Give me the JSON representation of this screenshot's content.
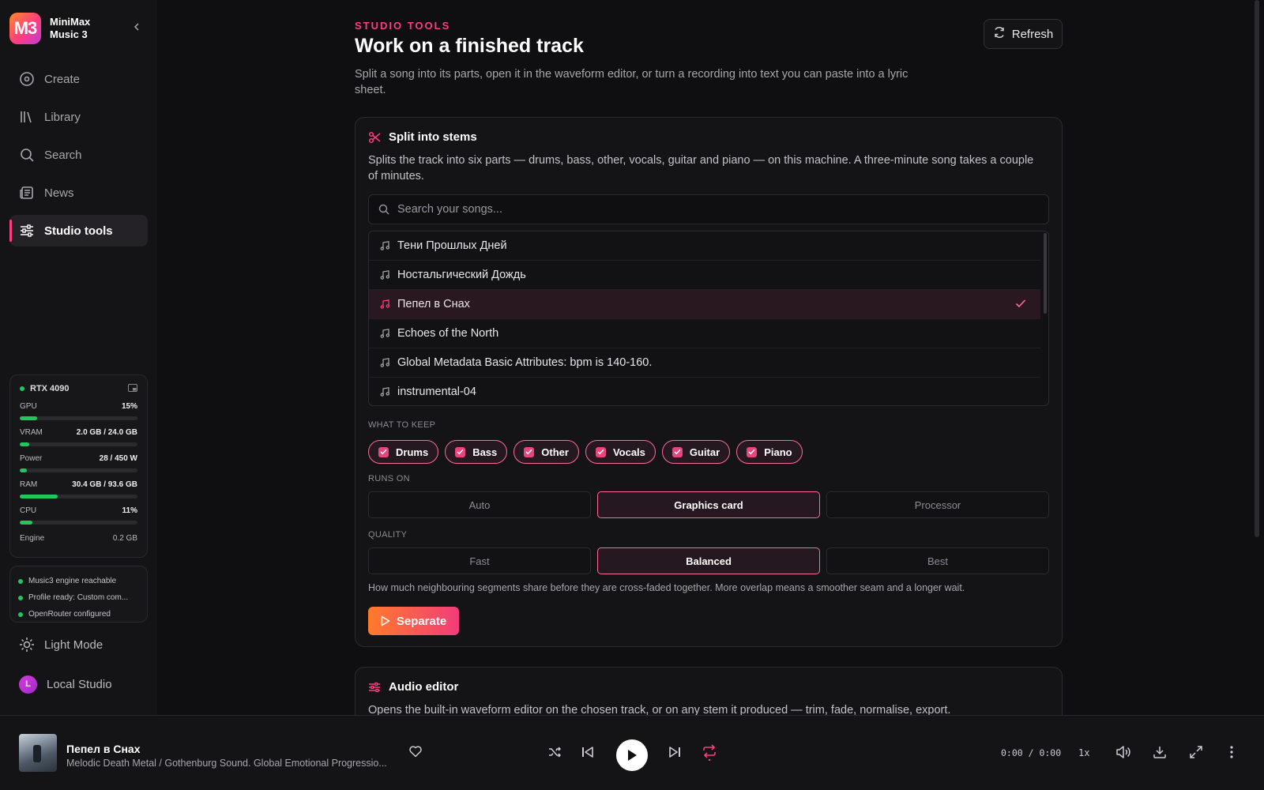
{
  "brand": {
    "logo": "M3",
    "name": "MiniMax Music 3"
  },
  "nav": [
    {
      "label": "Create",
      "icon": "disc-icon"
    },
    {
      "label": "Library",
      "icon": "library-icon"
    },
    {
      "label": "Search",
      "icon": "search-icon"
    },
    {
      "label": "News",
      "icon": "newspaper-icon"
    },
    {
      "label": "Studio tools",
      "icon": "sliders-icon",
      "active": true
    }
  ],
  "hardware": {
    "name": "RTX 4090",
    "metrics": [
      {
        "label": "GPU",
        "value": "15%",
        "fill": 0.15
      },
      {
        "label": "VRAM",
        "value": "2.0 GB / 24.0 GB",
        "fill": 0.083
      },
      {
        "label": "Power",
        "value": "28 / 450 W",
        "fill": 0.062
      },
      {
        "label": "RAM",
        "value": "30.4 GB / 93.6 GB",
        "fill": 0.325
      },
      {
        "label": "CPU",
        "value": "11%",
        "fill": 0.11
      }
    ],
    "engine_label": "Engine",
    "engine_value": "0.2 GB"
  },
  "status": [
    "Music3 engine reachable",
    "Profile ready: Custom com...",
    "OpenRouter configured"
  ],
  "sidebar_bottom": {
    "theme_label": "Light Mode",
    "user_initial": "L",
    "user_label": "Local Studio"
  },
  "page": {
    "eyebrow": "STUDIO TOOLS",
    "title": "Work on a finished track",
    "lead": "Split a song into its parts, open it in the waveform editor, or turn a recording into text you can paste into a lyric sheet.",
    "refresh_label": "Refresh"
  },
  "stems": {
    "title": "Split into stems",
    "desc": "Splits the track into six parts — drums, bass, other, vocals, guitar and piano — on this machine. A three-minute song takes a couple of minutes.",
    "search_placeholder": "Search your songs...",
    "songs": [
      "Тени Прошлых Дней",
      "Ностальгический Дождь",
      "Пепел в Снах",
      "Echoes of the North",
      "Global Metadata Basic Attributes: bpm is 140-160.",
      "instrumental-04"
    ],
    "selected_index": 2,
    "keep_label": "WHAT TO KEEP",
    "keep": [
      "Drums",
      "Bass",
      "Other",
      "Vocals",
      "Guitar",
      "Piano"
    ],
    "runs_label": "RUNS ON",
    "runs": [
      "Auto",
      "Graphics card",
      "Processor"
    ],
    "runs_selected": 1,
    "quality_label": "QUALITY",
    "quality": [
      "Fast",
      "Balanced",
      "Best"
    ],
    "quality_selected": 1,
    "hint": "How much neighbouring segments share before they are cross-faded together. More overlap means a smoother seam and a longer wait.",
    "action": "Separate"
  },
  "editor": {
    "title": "Audio editor",
    "desc": "Opens the built-in waveform editor on the chosen track, or on any stem it produced — trim, fade, normalise, export."
  },
  "player": {
    "title": "Пепел в Снах",
    "subtitle": "Melodic Death Metal / Gothenburg Sound. Global Emotional Progressio...",
    "time": "0:00 / 0:00",
    "speed": "1x"
  },
  "colors": {
    "accent": "#ff3d7f",
    "accent_orange": "#ff7a2a",
    "ok": "#22c55e",
    "bg": "#0f0e10"
  }
}
